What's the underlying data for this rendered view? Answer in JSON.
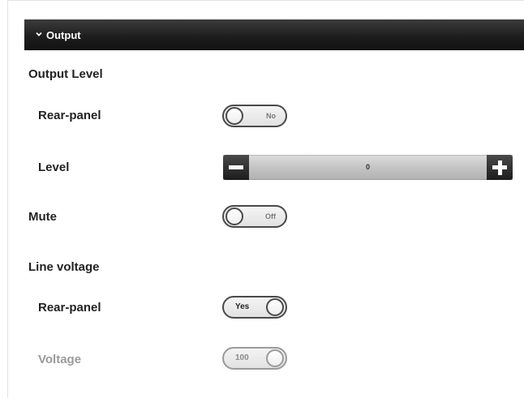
{
  "section": {
    "title": "Output",
    "expanded": true
  },
  "output_level": {
    "heading": "Output Level",
    "rear_panel": {
      "label": "Rear-panel",
      "state": "No"
    },
    "level": {
      "label": "Level",
      "value": "0"
    }
  },
  "mute": {
    "label": "Mute",
    "state": "Off"
  },
  "line_voltage": {
    "heading": "Line voltage",
    "rear_panel": {
      "label": "Rear-panel",
      "state": "Yes"
    },
    "voltage": {
      "label": "Voltage",
      "value": "100",
      "disabled": true
    }
  },
  "icons": {
    "section_toggle": "chevron-down-icon",
    "decrement": "minus-icon",
    "increment": "plus-icon"
  }
}
